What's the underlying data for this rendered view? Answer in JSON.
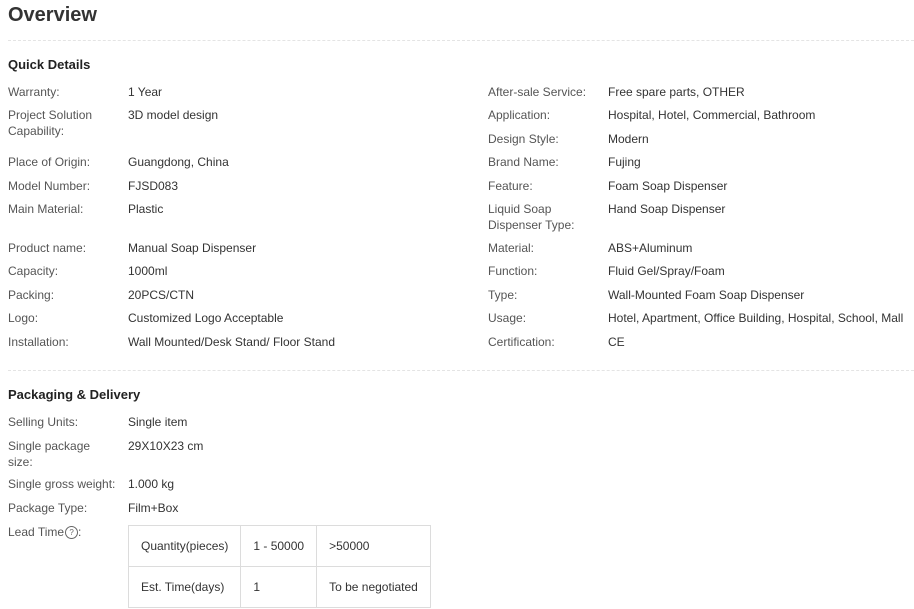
{
  "page_title": "Overview",
  "quick_details": {
    "heading": "Quick Details",
    "left": [
      {
        "label": "Warranty:",
        "value": "1 Year"
      },
      {
        "label": "Project Solution Capability:",
        "value": "3D model design"
      },
      {
        "label": "Place of Origin:",
        "value": "Guangdong, China"
      },
      {
        "label": "Model Number:",
        "value": "FJSD083"
      },
      {
        "label": "Main Material:",
        "value": "Plastic"
      },
      {
        "label": "Product name:",
        "value": "Manual Soap Dispenser"
      },
      {
        "label": "Capacity:",
        "value": "1000ml"
      },
      {
        "label": "Packing:",
        "value": "20PCS/CTN"
      },
      {
        "label": "Logo:",
        "value": "Customized Logo Acceptable"
      },
      {
        "label": "Installation:",
        "value": "Wall Mounted/Desk Stand/ Floor Stand"
      }
    ],
    "right": [
      {
        "label": "After-sale Service:",
        "value": "Free spare parts, OTHER"
      },
      {
        "label": "Application:",
        "value": "Hospital, Hotel, Commercial, Bathroom"
      },
      {
        "label": "Design Style:",
        "value": "Modern"
      },
      {
        "label": "Brand Name:",
        "value": "Fujing"
      },
      {
        "label": "Feature:",
        "value": "Foam Soap Dispenser"
      },
      {
        "label": "Liquid Soap Dispenser Type:",
        "value": "Hand Soap Dispenser"
      },
      {
        "label": "Material:",
        "value": "ABS+Aluminum"
      },
      {
        "label": "Function:",
        "value": "Fluid Gel/Spray/Foam"
      },
      {
        "label": "Type:",
        "value": "Wall-Mounted Foam Soap Dispenser"
      },
      {
        "label": "Usage:",
        "value": "Hotel, Apartment, Office Building, Hospital, School, Mall"
      },
      {
        "label": "Certification:",
        "value": "CE"
      }
    ]
  },
  "packaging": {
    "heading": "Packaging & Delivery",
    "rows": [
      {
        "label": "Selling Units:",
        "value": "Single item"
      },
      {
        "label": "Single package size:",
        "value": "29X10X23 cm"
      },
      {
        "label": "Single gross weight:",
        "value": "1.000 kg"
      },
      {
        "label": "Package Type:",
        "value": "Film+Box"
      }
    ],
    "lead_time": {
      "label": "Lead Time",
      "help_glyph": "?",
      "table": [
        [
          "Quantity(pieces)",
          "1 - 50000",
          ">50000"
        ],
        [
          "Est. Time(days)",
          "1",
          "To be negotiated"
        ]
      ]
    }
  }
}
